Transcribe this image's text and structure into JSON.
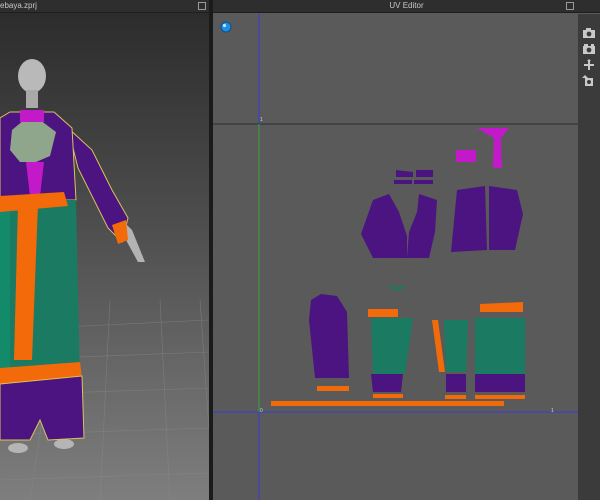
{
  "viewport": {
    "title": "ebaya.zprj"
  },
  "uv_editor": {
    "title": "UV Editor",
    "tick_bottom_left": "0",
    "tick_top_left": "1",
    "tick_bottom_right": "1"
  },
  "icons": {
    "maximize": "maximize-icon",
    "sphere": "sphere-icon",
    "tools": [
      "camera-capture-icon",
      "camera-settings-icon",
      "move-arrows-icon",
      "move-arrows-alt-icon"
    ]
  },
  "colors": {
    "purple": "#4b1480",
    "teal": "#1a7a62",
    "orange": "#f26a0a",
    "magenta": "#c21ac8",
    "guide_blue": "#3a3adb",
    "guide_green": "#3aa33a"
  }
}
